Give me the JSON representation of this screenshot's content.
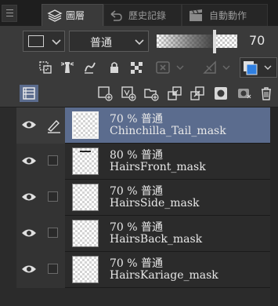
{
  "tabs": [
    {
      "label": "圖層",
      "icon": "layers-icon",
      "active": true
    },
    {
      "label": "歷史記錄",
      "icon": "undo-arrow-icon",
      "active": false
    },
    {
      "label": "自動動作",
      "icon": "clapper-icon",
      "active": false
    }
  ],
  "blend": {
    "mode": "普通",
    "opacity_value": "70",
    "opacity_percent": 70
  },
  "toolbar_row2": [
    "clip-to-layer-below-icon",
    "reference-lighthouse-icon",
    "draft-layer-icon",
    "lock-icon",
    "lock-transparent-pixels-icon",
    "mask-disabled-icon",
    "ruler-disabled-icon",
    "layer-color-icon"
  ],
  "toolbar_row3": [
    "layer-list-toggle-icon",
    "new-raster-layer-icon",
    "new-vector-layer-icon",
    "new-folder-icon",
    "transfer-to-below-icon",
    "combine-to-below-icon",
    "create-mask-icon",
    "apply-mask-icon",
    "delete-layer-icon"
  ],
  "layers": [
    {
      "line1": "70 % 普通",
      "line2": "Chinchilla_Tail_mask",
      "selected": true,
      "pen": true
    },
    {
      "line1": "80 % 普通",
      "line2": "HairsFront_mask",
      "selected": false,
      "pen": false
    },
    {
      "line1": "70 % 普通",
      "line2": "HairsSide_mask",
      "selected": false,
      "pen": false
    },
    {
      "line1": "70 % 普通",
      "line2": "HairsBack_mask",
      "selected": false,
      "pen": false
    },
    {
      "line1": "70 % 普通",
      "line2": "HairsKariage_mask",
      "selected": false,
      "pen": false
    }
  ],
  "colors": {
    "selected_row": "#5b6c8e",
    "panel_bg": "#2b2b2b",
    "toolbar_bg": "#3a3a3a",
    "accent_blue": "#2f7fe0"
  }
}
